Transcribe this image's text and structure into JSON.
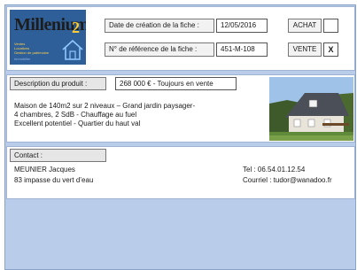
{
  "logo": {
    "title": "Millenium",
    "number": "2",
    "sub_lines": [
      "Ventes",
      "Locations",
      "Gestion de patrimoine",
      "Immobilier"
    ]
  },
  "header": {
    "creation_date_label": "Date de création de la fiche :",
    "creation_date_value": "12/05/2016",
    "reference_label": "N° de référence de la fiche :",
    "reference_value": "451-M-108",
    "achat_label": "ACHAT",
    "achat_checked": "",
    "vente_label": "VENTE",
    "vente_checked": "X"
  },
  "description": {
    "label": "Description du produit :",
    "price_status": "268 000 € - Toujours en vente",
    "lines": [
      "Maison de 140m2 sur 2 niveaux – Grand jardin paysager-",
      "4 chambres, 2 SdB - Chauffage au fuel",
      "Excellent potentiel - Quartier du haut val"
    ]
  },
  "contact": {
    "label": "Contact :",
    "name": "MEUNIER Jacques",
    "address": "83 impasse du vert d’eau",
    "phone": "Tel : 06.54.01.12.54",
    "email": "Courriel : tudor@wanadoo.fr"
  },
  "colors": {
    "sheet_background": "#b9cdea",
    "logo_background": "#2f5f98",
    "logo_accent": "#ffcc33"
  },
  "icons": {
    "logo_house": "house-outline-icon"
  }
}
